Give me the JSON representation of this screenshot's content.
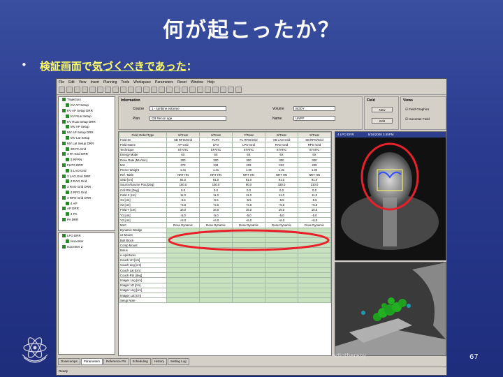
{
  "slide": {
    "title": "何が起こったか？",
    "bullet": "•",
    "subtitle_prefix": "検証画面で",
    "subtitle_underlined": "気づくべきであった",
    "subtitle_suffix": "：",
    "footer_text": "adiotherapy",
    "page_number": "67"
  },
  "app": {
    "menu": [
      "File",
      "Edit",
      "View",
      "Insert",
      "Planning",
      "Tools",
      "Workspace",
      "Parameters",
      "Reset",
      "Window",
      "Help"
    ],
    "tree_items": [
      "Trajectory",
      "KV AP Setup",
      "KV AP Setup DRR",
      "KV RLat Setup",
      "KV RLat Setup DRR",
      "MV AP Setup",
      "MV AP Setup DRR",
      "MV Lat Setup",
      "MV Lat Setup DRR",
      "3D PA Grid",
      "3 PA Grid DRR",
      "3 RFRN",
      "FLPO DRR",
      "3 LAO Grid",
      "3 LAO Grid DRR",
      "3 RAO Grid",
      "3 RAO Grid DRR",
      "3 RPO Grid",
      "3 RPO Grid DRR",
      "4 AP",
      "AP DRR",
      "4 PA",
      "PA DRR"
    ],
    "tree2_items": [
      "LFO DRR",
      "Isocenter",
      "Isocenter 2"
    ],
    "info": {
      "heading": "Information",
      "course_label": "Course",
      "course_value": "1 - lumbine extreme",
      "plan_label": "Plan",
      "plan_value": "CB Recon age",
      "volume_label": "Volume",
      "volume_value": "BODY",
      "name_label": "Name",
      "name_value": "UNPP"
    },
    "field": {
      "heading": "Field",
      "new_label": "New",
      "edit_label": "Edit"
    },
    "views": {
      "heading": "Views",
      "opt1": "Field Graphics",
      "opt2": "Isocenter Field"
    },
    "grid_headers": [
      "Field Order/Type",
      "5/Treat",
      "6/Treat",
      "7/Treat",
      "8/Treat",
      "9/Treat"
    ],
    "grid_rows": [
      {
        "label": "Field ID",
        "cells": [
          "SB RFIS/Grid",
          "FLPC",
          "FL RFIS/Grid",
          "VB LAO Grid",
          "SB RPO/Grid"
        ],
        "green": false
      },
      {
        "label": "Field Name",
        "cells": [
          "AP Grid",
          "LFO",
          "LPO Grid",
          "RAO Grid",
          "RPO Grid"
        ],
        "green": false
      },
      {
        "label": "Technique",
        "cells": [
          "STATIC",
          "STATIC",
          "STATIC",
          "STATIC",
          "STATIC"
        ],
        "green": false
      },
      {
        "label": "Energy Mode",
        "cells": [
          "6X",
          "6X",
          "6X",
          "6X",
          "6X"
        ],
        "green": false
      },
      {
        "label": "Dose Rate [MU/min]",
        "cells": [
          "300",
          "300",
          "300",
          "300",
          "300"
        ],
        "green": false
      },
      {
        "label": "MU",
        "cells": [
          "273",
          "234",
          "203",
          "222",
          "205"
        ],
        "green": false
      },
      {
        "label": "Prescr Weight",
        "cells": [
          "1.41",
          "1.41",
          "1.30",
          "1.31",
          "1.32"
        ],
        "green": false
      },
      {
        "label": "Ref. Table",
        "cells": [
          "NRT HN",
          "NRT HN",
          "NRT HN",
          "NRT HN",
          "NRT HN"
        ],
        "green": false
      },
      {
        "label": "SSD [cm]",
        "cells": [
          "91.0",
          "91.0",
          "91.0",
          "91.0",
          "91.0"
        ],
        "green": false
      },
      {
        "label": "Source/Source Pos.[Deg]",
        "cells": [
          "180.0",
          "100.0",
          "90.0",
          "330.0",
          "210.0"
        ],
        "green": false
      },
      {
        "label": "Coll Rtn [Deg]",
        "cells": [
          "0.0",
          "0.0",
          "0.0",
          "0.0",
          "0.0"
        ],
        "green": false
      },
      {
        "label": "Field X [cm]",
        "cells": [
          "11.0",
          "11.0",
          "11.0",
          "11.0",
          "11.0"
        ],
        "green": false
      },
      {
        "label": "X1 [cm]",
        "cells": [
          "-5.5",
          "-5.5",
          "-5.5",
          "-5.5",
          "-5.5"
        ],
        "green": false
      },
      {
        "label": "X2 [cm]",
        "cells": [
          "+5.5",
          "+5.5",
          "+5.5",
          "+5.5",
          "+5.5"
        ],
        "green": false
      },
      {
        "label": "Field Y [cm]",
        "cells": [
          "16.0",
          "16.0",
          "16.0",
          "16.0",
          "16.0"
        ],
        "green": false
      },
      {
        "label": "Y1 [cm]",
        "cells": [
          "-5.0",
          "-5.0",
          "-5.0",
          "-5.0",
          "-5.0"
        ],
        "green": false
      },
      {
        "label": "Y2 [cm]",
        "cells": [
          "+6.0",
          "+6.0",
          "+6.0",
          "+6.0",
          "+6.0"
        ],
        "green": false
      },
      {
        "label": "MLC",
        "cells": [
          "Dose Dynamic",
          "Dose Dynamic",
          "Dose Dynamic",
          "Dose Dynamic",
          "Dose Dynamic"
        ],
        "green": false
      },
      {
        "label": "Dynamic Wedge",
        "cells": [
          "",
          "",
          "",
          "",
          ""
        ],
        "green": true
      },
      {
        "label": "c2 Mount",
        "cells": [
          "",
          "",
          "",
          "",
          ""
        ],
        "green": true
      },
      {
        "label": "Bolt Block",
        "cells": [
          "",
          "",
          "",
          "",
          ""
        ],
        "green": true
      },
      {
        "label": "Comp Mount",
        "cells": [
          "",
          "",
          "",
          "",
          ""
        ],
        "green": true
      },
      {
        "label": "Bolus",
        "cells": [
          "",
          "",
          "",
          "",
          ""
        ],
        "green": true
      },
      {
        "label": "e-Apertures",
        "cells": [
          "",
          "",
          "",
          "",
          ""
        ],
        "green": true
      },
      {
        "label": "Couch Vrt [cm]",
        "cells": [
          "",
          "",
          "",
          "",
          ""
        ],
        "green": true
      },
      {
        "label": "Couch Lng [cm]",
        "cells": [
          "",
          "",
          "",
          "",
          ""
        ],
        "green": true
      },
      {
        "label": "Couch Lat [cm]",
        "cells": [
          "",
          "",
          "",
          "",
          ""
        ],
        "green": true
      },
      {
        "label": "Couch Rtn [deg]",
        "cells": [
          "",
          "",
          "",
          "",
          ""
        ],
        "green": true
      },
      {
        "label": "Imager Lng [cm]",
        "cells": [
          "",
          "",
          "",
          "",
          ""
        ],
        "green": true
      },
      {
        "label": "Imager Vrt [cm]",
        "cells": [
          "",
          "",
          "",
          "",
          ""
        ],
        "green": true
      },
      {
        "label": "Imager Lng [cm]",
        "cells": [
          "",
          "",
          "",
          "",
          ""
        ],
        "green": true
      },
      {
        "label": "Imager Lat [cm]",
        "cells": [
          "",
          "",
          "",
          "",
          ""
        ],
        "green": true
      },
      {
        "label": "Setup Note",
        "cells": [
          "",
          "",
          "",
          "",
          ""
        ],
        "green": true
      }
    ],
    "drr_label": "4 LPO DRR",
    "drr_date": "5/16/2008 3:45PM",
    "tabs": [
      "Dosecomps",
      "Parameters",
      "Reference Pts",
      "Scheduling",
      "History",
      "Setting Log"
    ],
    "status": "Ready",
    "highlight_color": "#e8202a",
    "grid_green": "#c8e2c0"
  }
}
